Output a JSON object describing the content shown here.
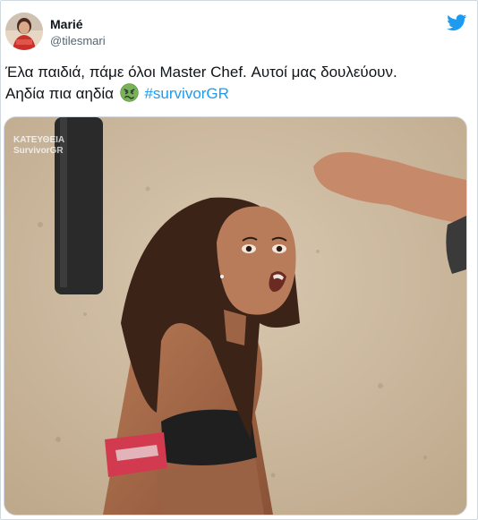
{
  "tweet": {
    "author": {
      "display_name": "Marié",
      "handle": "@tilesmari",
      "avatar_icon": "profile-avatar"
    },
    "brand_icon": "twitter-bird-icon",
    "brand_color": "#1d9bf0",
    "text_line1": "Έλα παιδιά, πάμε όλοι Master Chef. Αυτοί μας δουλεύουν.",
    "text_line2": "Αηδία πια αηδία",
    "emoji": "nauseated-face-emoji",
    "hashtag": "#survivorGR",
    "hashtag_color": "#1d9bf0",
    "media": {
      "subject": "photo",
      "watermark_line1": "ΚΑΤΕΥΘΕΙΑ",
      "watermark_line2": "SurvivorGR"
    }
  }
}
